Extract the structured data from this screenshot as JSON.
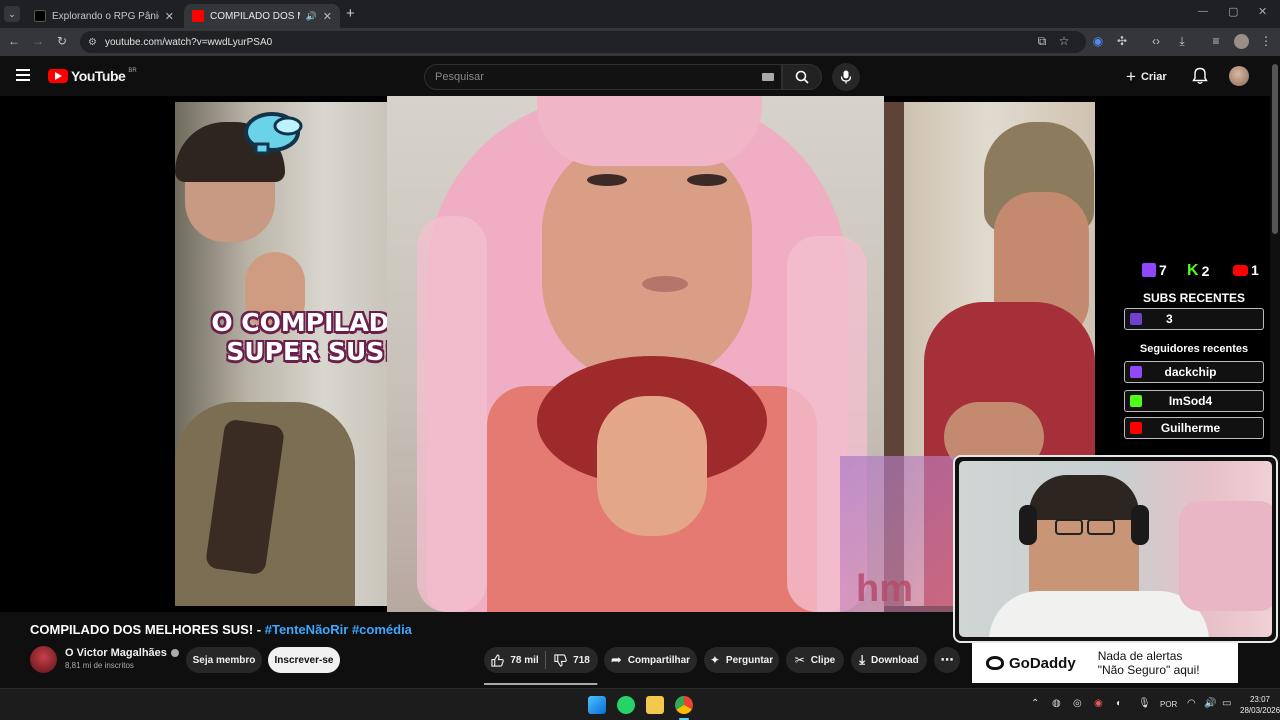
{
  "browser": {
    "tabs": [
      {
        "title": "Explorando o RPG Pânico: Perso",
        "active": false
      },
      {
        "title": "COMPILADO DOS MELHORES",
        "active": true
      }
    ],
    "url": "youtube.com/watch?v=wwdLyurPSA0"
  },
  "youtube": {
    "logo_text": "YouTube",
    "region": "BR",
    "search_placeholder": "Pesquisar",
    "create_label": "Criar"
  },
  "video": {
    "overlay_title_line1": "O COMPILADO",
    "overlay_title_line2": "SUPER SUS!",
    "counters": [
      {
        "platform": "twitch",
        "value": "7",
        "color": "#9146ff"
      },
      {
        "platform": "kick",
        "value": "2",
        "color": "#53fc18"
      },
      {
        "platform": "youtube",
        "value": "1",
        "color": "#ff0000"
      }
    ],
    "subs_heading": "SUBS RECENTES",
    "subs_value": "3",
    "followers_heading": "Seguidores recentes",
    "followers": [
      {
        "name": "dackchip",
        "platform": "twitch",
        "color": "#9146ff"
      },
      {
        "name": "ImSod4",
        "platform": "kick",
        "color": "#53fc18"
      },
      {
        "name": "Guilherme",
        "platform": "youtube",
        "color": "#ff0000"
      }
    ],
    "hm_text": "hm"
  },
  "meta": {
    "title_main": "COMPILADO DOS MELHORES SUS! -",
    "hashtag1": "#TenteNãoRir",
    "hashtag2": "#comédia",
    "channel_name": "O Victor Magalhães",
    "subscribers": "8,81 mi de inscritos",
    "join_label": "Seja membro",
    "subscribe_label": "Inscrever-se",
    "likes": "78 mil",
    "dislikes": "718",
    "share_label": "Compartilhar",
    "ask_label": "Perguntar",
    "clip_label": "Clipe",
    "download_label": "Download",
    "more_label": "⋯"
  },
  "ad": {
    "brand": "GoDaddy",
    "line1": "Nada de alertas",
    "line2": "\"Não Seguro\" aqui!"
  },
  "taskbar": {
    "lang": "POR",
    "time": "23:07",
    "date": "28/03/2026"
  }
}
